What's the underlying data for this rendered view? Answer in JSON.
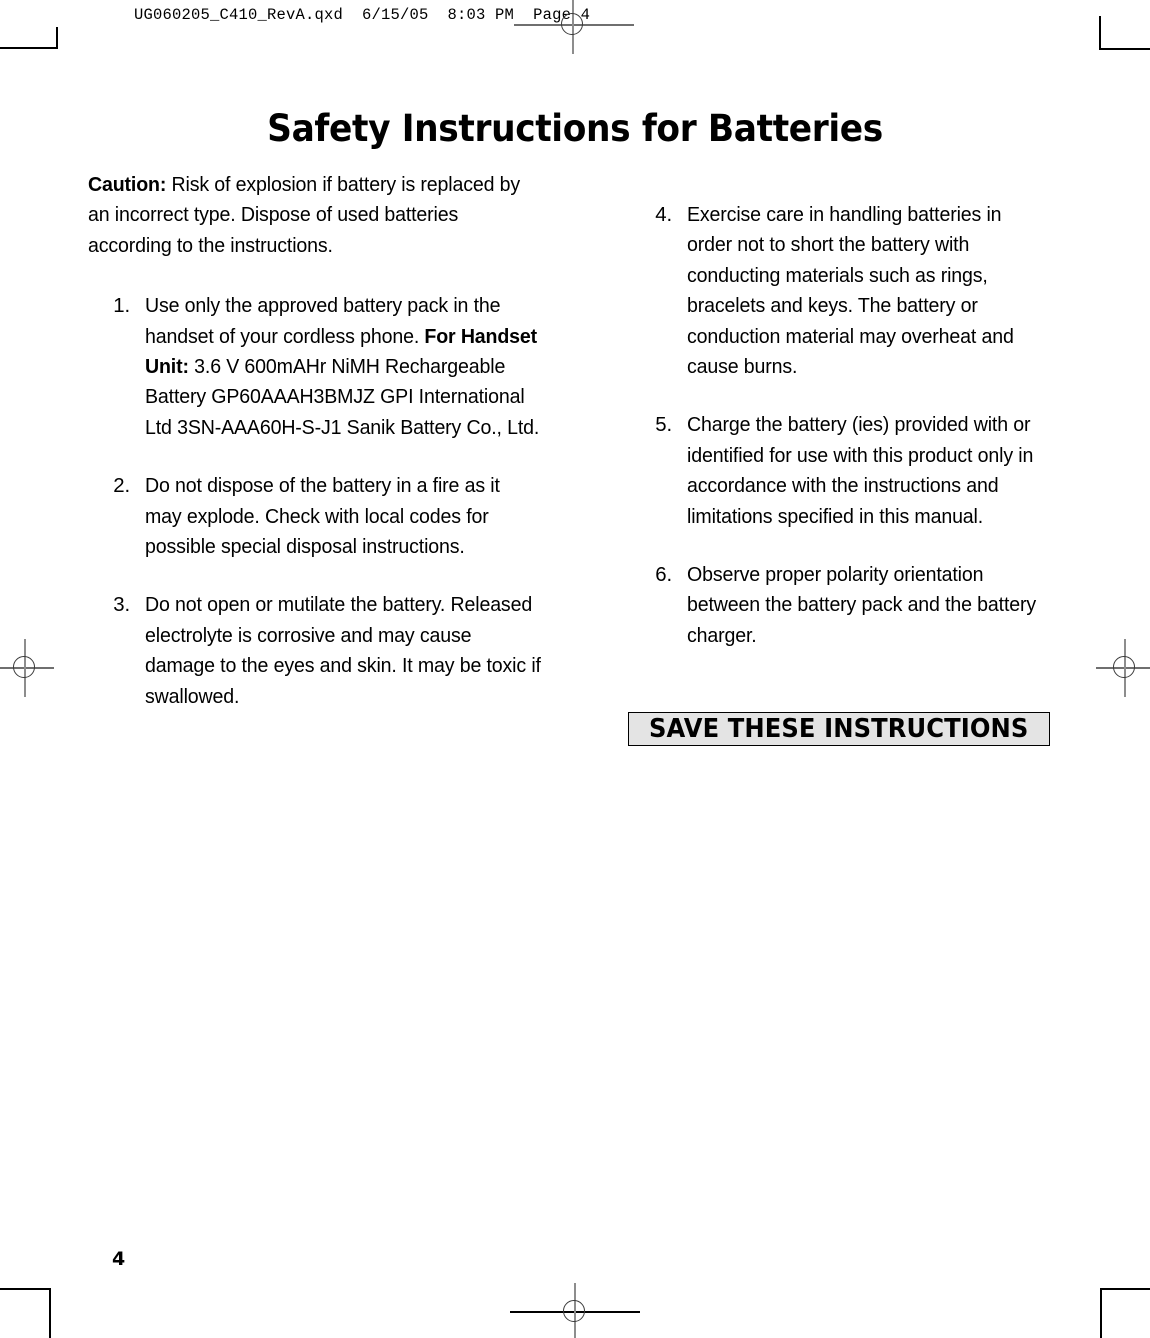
{
  "proof_header": "UG060205_C410_RevA.qxd  6/15/05  8:03 PM  Page 4",
  "title": "Safety Instructions for Batteries",
  "caution": {
    "label": "Caution:",
    "text": " Risk of explosion if battery is replaced by an incorrect type.  Dispose of used batteries according to the instructions."
  },
  "left_column": {
    "steps": [
      {
        "number": "1.",
        "text_before": "Use only the approved battery pack in the handset of your cordless phone. ",
        "bold": "For Handset Unit:",
        "text_after": " 3.6 V 600mAHr NiMH Rechargeable Battery GP60AAAH3BMJZ GPI International Ltd 3SN-AAA60H-S-J1 Sanik Battery Co., Ltd."
      },
      {
        "number": "2.",
        "text": "Do not dispose of the battery in a fire as it may explode. Check with local codes for possible special disposal instructions."
      },
      {
        "number": "3.",
        "text": "Do not open or mutilate the battery. Released electrolyte is corrosive and may cause damage to the eyes and skin. It may be toxic if swallowed."
      }
    ]
  },
  "right_column": {
    "steps": [
      {
        "number": "4.",
        "text": "Exercise care in handling batteries in order not to short the battery with conducting materials such as rings, bracelets and keys. The battery or conduction material may overheat and cause burns."
      },
      {
        "number": "5.",
        "text": "Charge the battery (ies) provided with or identified for use with this product only in accordance with the instructions and limitations specified in this manual."
      },
      {
        "number": "6.",
        "text": "Observe proper polarity orientation between the battery pack and the battery charger."
      }
    ]
  },
  "save_box": {
    "label": "SAVE THESE INSTRUCTIONS",
    "fill_color": "#e4e4e4",
    "border_color": "#000000"
  },
  "page_number": "4"
}
